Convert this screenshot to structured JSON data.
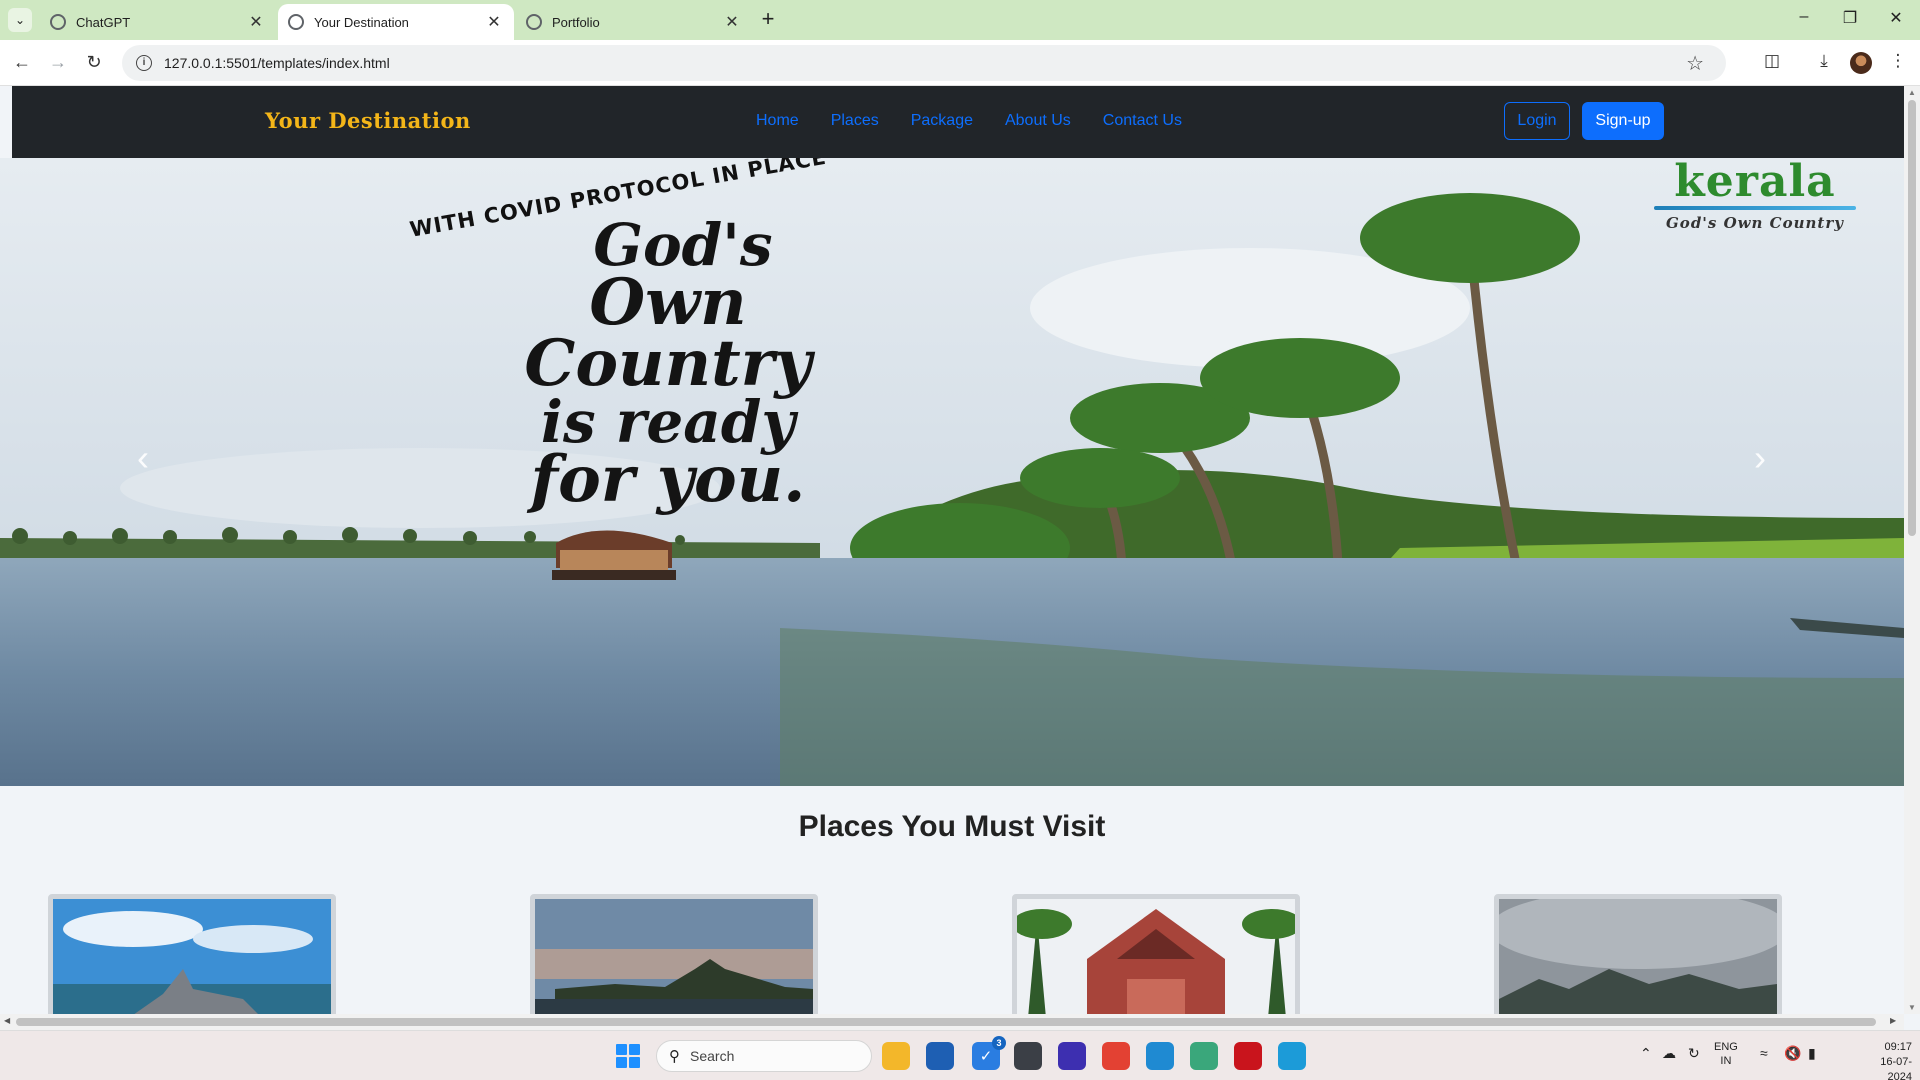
{
  "browser": {
    "tabs": [
      {
        "title": "ChatGPT",
        "active": false
      },
      {
        "title": "Your Destination",
        "active": true
      },
      {
        "title": "Portfolio",
        "active": false
      }
    ],
    "url": "127.0.0.1:5501/templates/index.html"
  },
  "site": {
    "brand": "Your Destination",
    "nav": [
      "Home",
      "Places",
      "Package",
      "About Us",
      "Contact Us"
    ],
    "login_label": "Login",
    "signup_label": "Sign-up",
    "nav_color": "#0d6efd",
    "brand_color": "#f4b619",
    "nav_bg": "#212529"
  },
  "hero": {
    "covid_line": "WITH COVID PROTOCOL IN PLACE",
    "tagline": [
      "God's",
      "Own Country",
      "is ready",
      "for you."
    ],
    "logo_word": "kerala",
    "logo_tagline": "God's Own Country",
    "prev_icon": "chevron-left-icon",
    "next_icon": "chevron-right-icon"
  },
  "places": {
    "title": "Places You Must Visit",
    "cards": [
      {
        "image": "hill-viewpoint-with-statue"
      },
      {
        "image": "temple-by-lake-at-dusk"
      },
      {
        "image": "red-heritage-palace"
      },
      {
        "image": "misty-mountain-peaks"
      }
    ]
  },
  "taskbar": {
    "search_placeholder": "Search",
    "badge_count": "3",
    "lang_line1": "ENG",
    "lang_line2": "IN",
    "time": "09:17",
    "date": "16-07-2024"
  }
}
